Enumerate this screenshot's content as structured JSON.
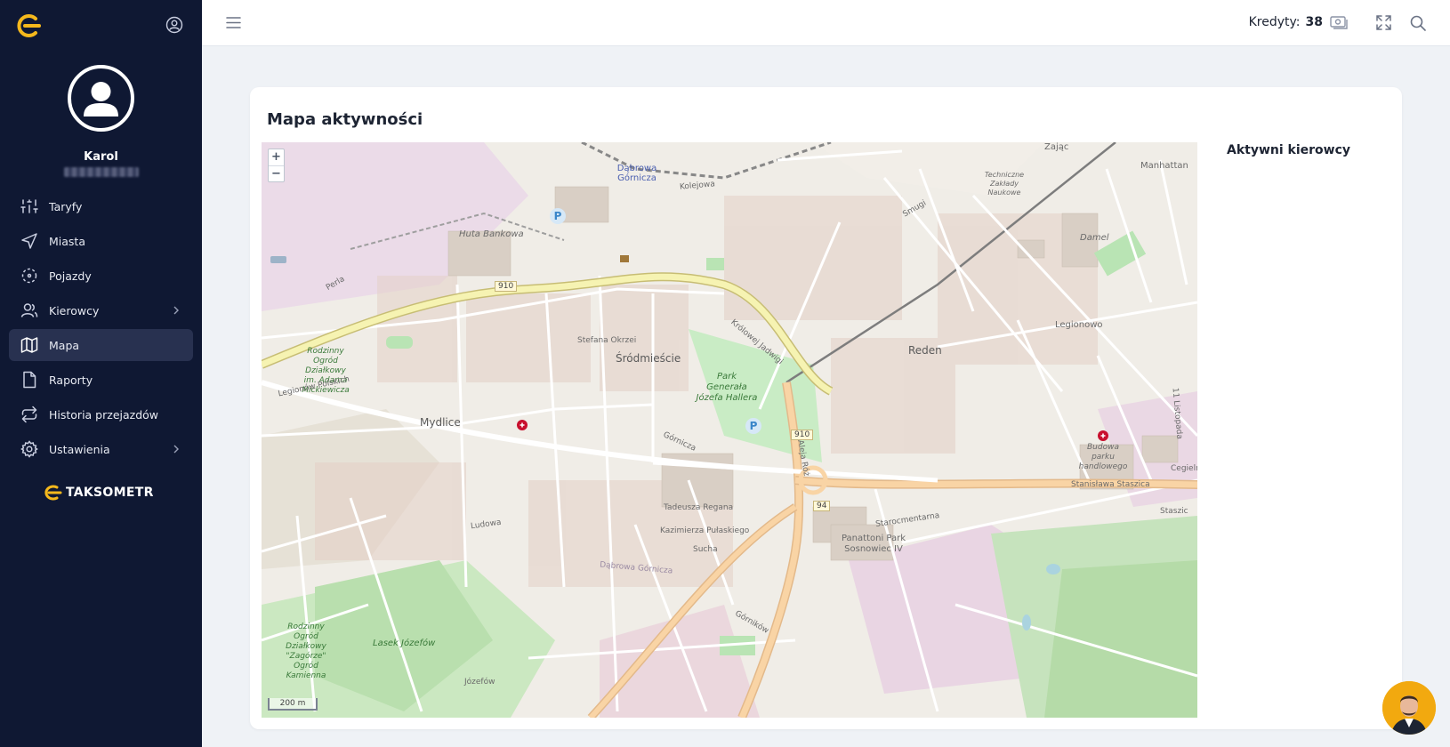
{
  "sidebar": {
    "user_name": "Karol",
    "items": [
      {
        "label": "Taryfy",
        "icon": "sliders-icon"
      },
      {
        "label": "Miasta",
        "icon": "navigation-icon"
      },
      {
        "label": "Pojazdy",
        "icon": "vehicle-scan-icon"
      },
      {
        "label": "Kierowcy",
        "icon": "users-icon",
        "has_submenu": true
      },
      {
        "label": "Mapa",
        "icon": "map-icon",
        "active": true
      },
      {
        "label": "Raporty",
        "icon": "file-icon"
      },
      {
        "label": "Historia przejazdów",
        "icon": "repeat-icon"
      },
      {
        "label": "Ustawienia",
        "icon": "gear-icon",
        "has_submenu": true
      }
    ],
    "brand": "TAKSOMETR"
  },
  "header": {
    "credits_label": "Kredyty:",
    "credits_value": "38"
  },
  "card": {
    "title": "Mapa aktywności",
    "side_title": "Aktywni kierowcy"
  },
  "map": {
    "zoom_in": "+",
    "zoom_out": "−",
    "scale": "200 m",
    "labels": {
      "dabrowa": "Dąbrowa Górnicza",
      "huta": "Huta Bankowa",
      "srodmiescie": "Śródmieście",
      "reden": "Reden",
      "mydlice": "Mydlice",
      "park_hallera": "Park Generała Józefa Hallera",
      "panattoni": "Panattoni Park Sosnowiec IV",
      "lasek": "Lasek Józefów",
      "legionowo": "Legionowo",
      "manhattan": "Manhattan",
      "zajac": "Zając",
      "damel": "Damel",
      "ogrod": "Rodzinny Ogród Działkowy im. Adama Mickiewicza",
      "ogrod2": "Rodzinny Ogród Działkowy \"Zagórze\" Ogród Kamienna",
      "budowa": "Budowa parku handlowego",
      "road_910a": "910",
      "road_910b": "910",
      "road_94": "94",
      "krolowej": "Królowej Jadwigi",
      "aleja_roz": "Aleja Róż",
      "stanislawa": "Stanisława Staszica",
      "legionow": "Legionów Polskich",
      "gornicza": "Górnicza",
      "cegielnia": "Cegielnia",
      "staszic": "Staszic",
      "starocmentarna": "Starocmentarna",
      "kolejowa": "Kolejowa",
      "jozefow": "Józefów",
      "dabrowa_st": "Dąbrowa Górnicza",
      "technikum": "Techniczne Zakłady Naukowe",
      "smugi": "Smugi",
      "stefana": "Stefana Okrzei",
      "ludowa": "Ludowa",
      "sucha": "Sucha",
      "tadeusza": "Tadeusza Regana",
      "kazimierza": "Kazimierza Pułaskiego",
      "gornikow": "Górników",
      "perla": "Perla",
      "listopada": "11 Listopada"
    }
  },
  "colors": {
    "sidebar_bg": "#0f1833",
    "accent": "#f5b81c"
  }
}
